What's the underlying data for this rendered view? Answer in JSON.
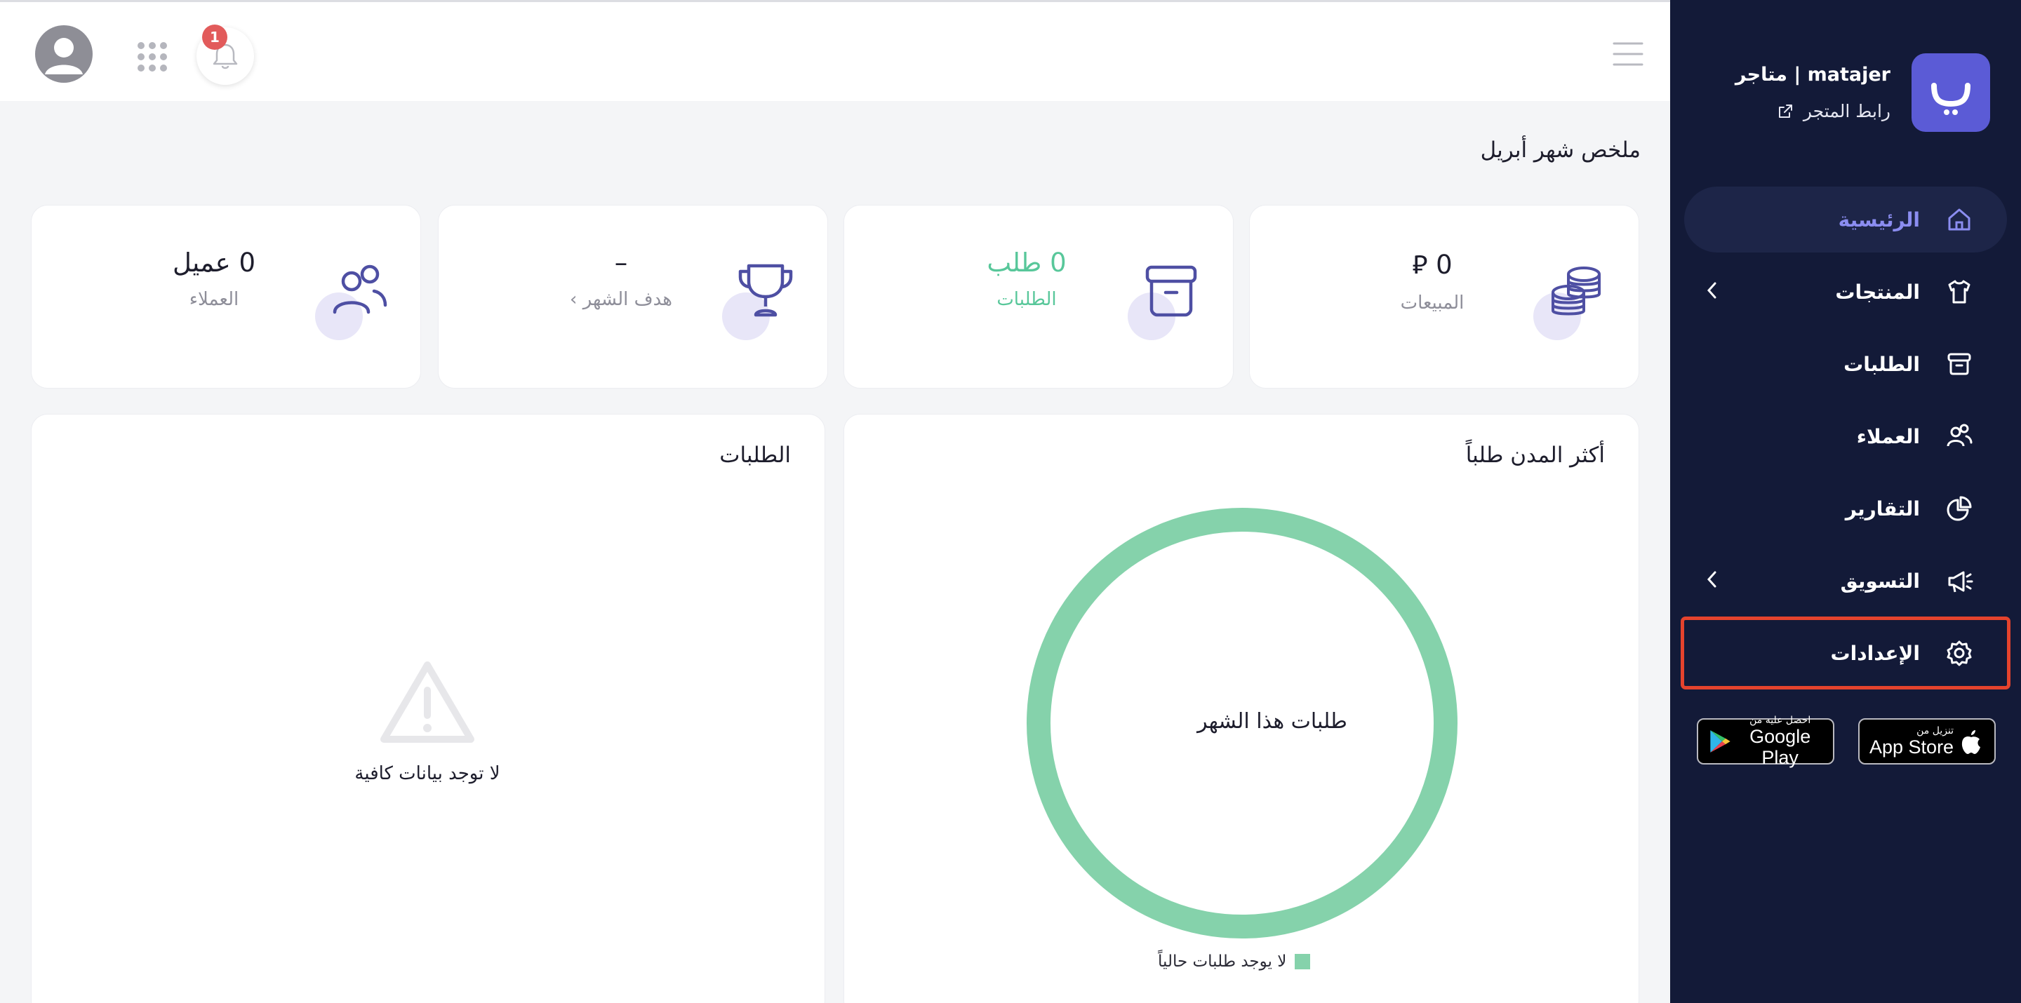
{
  "brand": {
    "name": "matajer | متاجر",
    "store_link": "رابط المتجر"
  },
  "nav": {
    "items": [
      {
        "label": "الرئيسية",
        "icon": "home-icon",
        "active": true
      },
      {
        "label": "المنتجات",
        "icon": "shirt-icon",
        "has_submenu": true
      },
      {
        "label": "الطلبات",
        "icon": "archive-box-icon"
      },
      {
        "label": "العملاء",
        "icon": "users-icon"
      },
      {
        "label": "التقارير",
        "icon": "pie-chart-icon"
      },
      {
        "label": "التسويق",
        "icon": "megaphone-icon",
        "has_submenu": true
      },
      {
        "label": "الإعدادات",
        "icon": "gear-icon",
        "highlighted": true
      }
    ]
  },
  "stores": {
    "google_small": "احصل عليه من",
    "google_big": "Google Play",
    "apple_small": "تنزيل من",
    "apple_big": "App Store"
  },
  "topbar": {
    "notification_count": "1"
  },
  "summary": {
    "title": "ملخص شهر أبريل"
  },
  "stats": [
    {
      "value": "0 ⃁",
      "label": "المبيعات",
      "icon": "coins-icon"
    },
    {
      "value": "0 طلب",
      "label": "الطلبات",
      "icon": "archive-box-icon",
      "accent": "#58c79a"
    },
    {
      "value": "–",
      "label": "هدف الشهر ›",
      "icon": "trophy-icon"
    },
    {
      "value": "0 عميل",
      "label": "العملاء",
      "icon": "users-icon"
    }
  ],
  "top_cities": {
    "title": "أكثر المدن طلباً",
    "center_label": "طلبات هذا الشهر",
    "legend": "لا يوجد طلبات حالياً"
  },
  "chart_data": {
    "type": "pie",
    "title": "أكثر المدن طلباً",
    "categories": [
      "لا يوجد طلبات حالياً"
    ],
    "values": [
      1
    ],
    "colors": [
      "#85d2ab"
    ]
  },
  "orders_panel": {
    "title": "الطلبات",
    "empty_text": "لا توجد بيانات كافية"
  },
  "colors": {
    "sidebar_bg": "#131a38",
    "accent": "#5b5bd6",
    "active_text": "#8b8df0",
    "green": "#58c79a",
    "highlight_border": "#e5432d"
  }
}
